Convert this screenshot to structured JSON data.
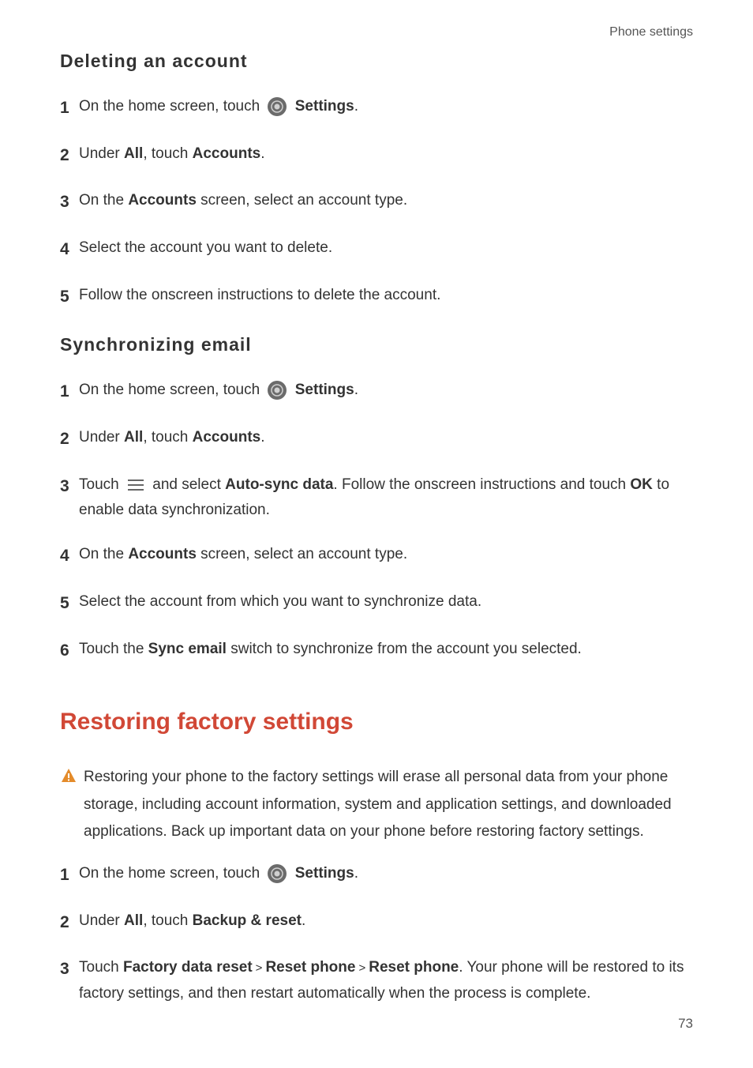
{
  "header": {
    "category": "Phone settings"
  },
  "section1": {
    "title": "Deleting an account",
    "steps": [
      {
        "n": "1",
        "pre": "On the home screen, touch ",
        "icon": "settings",
        "bold": "Settings",
        "post": "."
      },
      {
        "n": "2",
        "parts": [
          [
            "",
            "Under "
          ],
          [
            "b",
            "All"
          ],
          [
            "",
            " , touch "
          ],
          [
            "b",
            "Accounts"
          ],
          [
            "",
            "."
          ]
        ]
      },
      {
        "n": "3",
        "parts": [
          [
            "",
            "On the "
          ],
          [
            "b",
            "Accounts"
          ],
          [
            "",
            " screen, select an account type."
          ]
        ]
      },
      {
        "n": "4",
        "parts": [
          [
            "",
            "Select the account you want to delete."
          ]
        ]
      },
      {
        "n": "5",
        "parts": [
          [
            "",
            "Follow the onscreen instructions to delete the account."
          ]
        ]
      }
    ]
  },
  "section2": {
    "title": "Synchronizing email",
    "steps": [
      {
        "n": "1",
        "pre": "On the home screen, touch ",
        "icon": "settings",
        "bold": "Settings",
        "post": "."
      },
      {
        "n": "2",
        "parts": [
          [
            "",
            "Under "
          ],
          [
            "b",
            "All"
          ],
          [
            "",
            " , touch "
          ],
          [
            "b",
            "Accounts"
          ],
          [
            "",
            "."
          ]
        ]
      },
      {
        "n": "3",
        "special": "menu",
        "pre": "Touch ",
        "mid1": " and select ",
        "b1": "Auto-sync data",
        "mid2": ". Follow the onscreen instructions and touch ",
        "b2": "OK",
        "mid3": " to enable data synchronization."
      },
      {
        "n": "4",
        "parts": [
          [
            "",
            "On the "
          ],
          [
            "b",
            "Accounts"
          ],
          [
            "",
            " screen, select an account type."
          ]
        ]
      },
      {
        "n": "5",
        "parts": [
          [
            "",
            "Select the account from which you want to synchronize data."
          ]
        ]
      },
      {
        "n": "6",
        "parts": [
          [
            "",
            "Touch the "
          ],
          [
            "b",
            "Sync email"
          ],
          [
            "",
            " switch to synchronize from the account you selected."
          ]
        ]
      }
    ]
  },
  "section3": {
    "title": "Restoring factory settings",
    "warning": "Restoring your phone to the factory settings will erase all personal data from your phone storage, including account information, system and application settings, and downloaded applications. Back up important data on your phone before restoring factory settings.",
    "steps": [
      {
        "n": "1",
        "pre": "On the home screen, touch ",
        "icon": "settings",
        "bold": "Settings",
        "post": "."
      },
      {
        "n": "2",
        "parts": [
          [
            "",
            "Under "
          ],
          [
            "b",
            "All"
          ],
          [
            "",
            " , touch "
          ],
          [
            "b",
            "Backup & reset"
          ],
          [
            "",
            "."
          ]
        ]
      },
      {
        "n": "3",
        "special": "reset",
        "pre": "Touch ",
        "b1": "Factory data reset",
        "gt1": ">",
        "b2": "Reset phone",
        "gt2": ">",
        "b3": "Reset phone",
        "post": ". Your phone will be restored to its factory settings, and then restart automatically when the process is complete."
      }
    ]
  },
  "page_number": "73"
}
